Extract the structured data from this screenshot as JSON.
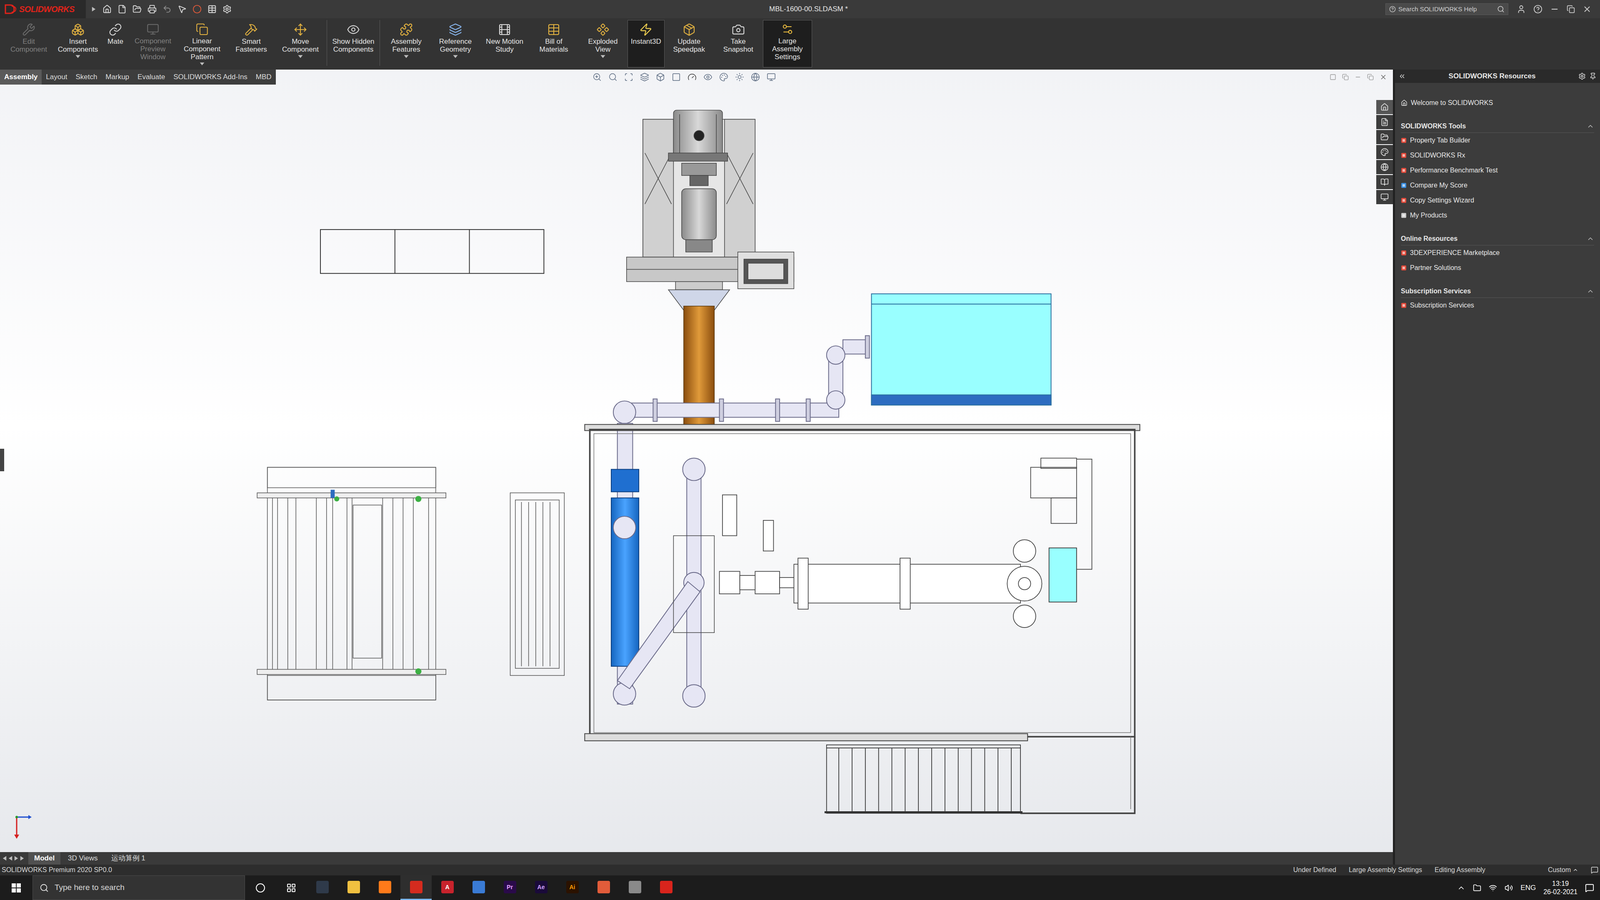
{
  "window": {
    "logo": "SOLIDWORKS",
    "title": "MBL-1600-00.SLDASM *",
    "search_placeholder": "Search SOLIDWORKS Help"
  },
  "ribbon": {
    "buttons": [
      {
        "label": "Edit Component",
        "disabled": true,
        "selected": false,
        "dropdown": false,
        "group": 1
      },
      {
        "label": "Insert Components",
        "disabled": false,
        "selected": false,
        "dropdown": true,
        "group": 1
      },
      {
        "label": "Mate",
        "disabled": false,
        "selected": false,
        "dropdown": false,
        "group": 1
      },
      {
        "label": "Component Preview Window",
        "disabled": true,
        "selected": false,
        "dropdown": false,
        "group": 1
      },
      {
        "label": "Linear Component Pattern",
        "disabled": false,
        "selected": false,
        "dropdown": true,
        "group": 1
      },
      {
        "label": "Smart Fasteners",
        "disabled": false,
        "selected": false,
        "dropdown": false,
        "group": 1
      },
      {
        "label": "Move Component",
        "disabled": false,
        "selected": false,
        "dropdown": true,
        "group": 1
      },
      {
        "label": "Show Hidden Components",
        "disabled": false,
        "selected": false,
        "dropdown": false,
        "group": 2
      },
      {
        "label": "Assembly Features",
        "disabled": false,
        "selected": false,
        "dropdown": true,
        "group": 3
      },
      {
        "label": "Reference Geometry",
        "disabled": false,
        "selected": false,
        "dropdown": true,
        "group": 3
      },
      {
        "label": "New Motion Study",
        "disabled": false,
        "selected": false,
        "dropdown": false,
        "group": 3
      },
      {
        "label": "Bill of Materials",
        "disabled": false,
        "selected": false,
        "dropdown": false,
        "group": 3
      },
      {
        "label": "Exploded View",
        "disabled": false,
        "selected": false,
        "dropdown": true,
        "group": 3
      },
      {
        "label": "Instant3D",
        "disabled": false,
        "selected": true,
        "dropdown": false,
        "group": 3
      },
      {
        "label": "Update Speedpak",
        "disabled": false,
        "selected": false,
        "dropdown": false,
        "group": 3
      },
      {
        "label": "Take Snapshot",
        "disabled": false,
        "selected": false,
        "dropdown": false,
        "group": 3
      },
      {
        "label": "Large Assembly Settings",
        "disabled": false,
        "selected": true,
        "dropdown": false,
        "group": 3
      }
    ]
  },
  "tabs": [
    {
      "label": "Assembly",
      "selected": true
    },
    {
      "label": "Layout",
      "selected": false
    },
    {
      "label": "Sketch",
      "selected": false
    },
    {
      "label": "Markup",
      "selected": false
    },
    {
      "label": "Evaluate",
      "selected": false
    },
    {
      "label": "SOLIDWORKS Add-Ins",
      "selected": false
    },
    {
      "label": "MBD",
      "selected": false
    }
  ],
  "task_pane": {
    "title": "SOLIDWORKS Resources",
    "welcome": "Welcome to SOLIDWORKS",
    "sections": [
      {
        "title": "SOLIDWORKS Tools",
        "expanded": true,
        "items": [
          "Property Tab Builder",
          "SOLIDWORKS Rx",
          "Performance Benchmark Test",
          "Compare My Score",
          "Copy Settings Wizard",
          "My Products"
        ]
      },
      {
        "title": "Online Resources",
        "expanded": true,
        "items": [
          "3DEXPERIENCE Marketplace",
          "Partner Solutions"
        ]
      },
      {
        "title": "Subscription Services",
        "expanded": true,
        "items": [
          "Subscription Services"
        ]
      }
    ]
  },
  "model_tabs": [
    {
      "label": "Model",
      "selected": true
    },
    {
      "label": "3D Views",
      "selected": false
    },
    {
      "label": "运动算例 1",
      "selected": false
    }
  ],
  "status_bar": {
    "product": "SOLIDWORKS Premium 2020 SP0.0",
    "items": [
      "Under Defined",
      "Large Assembly Settings",
      "Editing Assembly"
    ],
    "units": "Custom"
  },
  "taskbar": {
    "search_placeholder": "Type here to search",
    "apps": [
      {
        "label": "",
        "color": "#2f3a4a",
        "text_color": "#ffffff",
        "active": false
      },
      {
        "label": "",
        "color": "#f0c040",
        "text_color": "#000000",
        "active": false
      },
      {
        "label": "",
        "color": "#ff7a1a",
        "text_color": "#ffffff",
        "active": false
      },
      {
        "label": "",
        "color": "#d52b1e",
        "text_color": "#ffffff",
        "active": true
      },
      {
        "label": "A",
        "color": "#c8232c",
        "text_color": "#ffffff",
        "active": false
      },
      {
        "label": "",
        "color": "#3a7bd5",
        "text_color": "#ffffff",
        "active": false
      },
      {
        "label": "Pr",
        "color": "#2a0a4a",
        "text_color": "#e3a0ff",
        "active": false
      },
      {
        "label": "Ae",
        "color": "#1a0a3a",
        "text_color": "#cfa0ff",
        "active": false
      },
      {
        "label": "Ai",
        "color": "#2b1200",
        "text_color": "#ff9a00",
        "active": false
      },
      {
        "label": "",
        "color": "#e25c3a",
        "text_color": "#ffffff",
        "active": false
      },
      {
        "label": "",
        "color": "#8a8a8a",
        "text_color": "#ffffff",
        "active": false
      },
      {
        "label": "",
        "color": "#d9241c",
        "text_color": "#ffffff",
        "active": false
      }
    ],
    "language": "ENG",
    "time": "13:19",
    "date": "26-02-2021"
  }
}
